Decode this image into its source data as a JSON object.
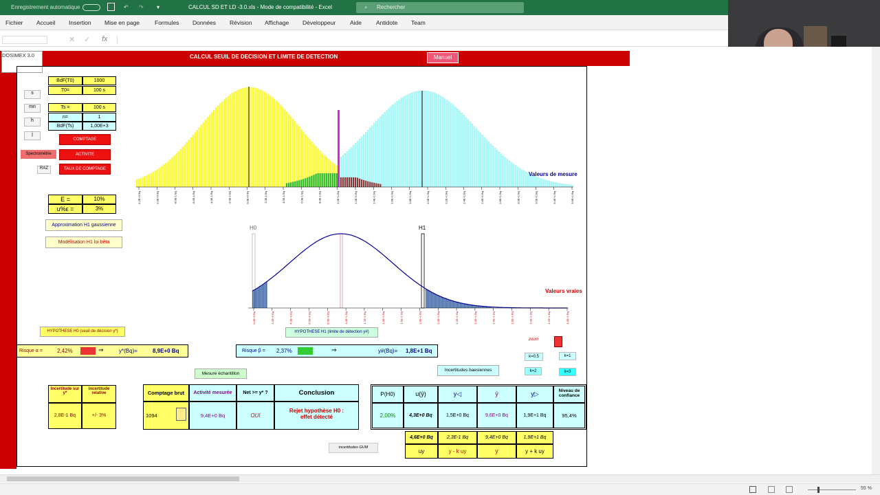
{
  "titlebar": {
    "autosave": "Enregistrement automatique",
    "doc_title": "CALCUL SD ET LD -3.0.xls  -  Mode de compatibilité  -  Excel",
    "search_placeholder": "Rechercher"
  },
  "ribbon": {
    "tabs": [
      "Fichier",
      "Accueil",
      "Insertion",
      "Mise en page",
      "Formules",
      "Données",
      "Révision",
      "Affichage",
      "Développeur",
      "Aide",
      "Antidote",
      "Team"
    ]
  },
  "formula_bar": {
    "fx": "fx"
  },
  "sheet": {
    "logo": "DOSIMEX 3.0",
    "banner_title": "CALCUL SEUIL DE DECISION ET LIMITE DE DETECTION",
    "manual_button": "Manuel",
    "time_units": [
      "s",
      "mn",
      "h",
      "j"
    ],
    "spectrometrie": "Spectrométrie",
    "raz": "RAZ",
    "mode_buttons": [
      "COMPTAGE",
      "ACTIVITE",
      "TAUX DE COMPTAGE"
    ],
    "params": {
      "bdf_label": "BdF(T0)",
      "bdf_value": "1000",
      "t0_label": "T0=",
      "t0_value": "100 s",
      "ts_label": "Ts =",
      "ts_value": "100 s",
      "n_label": "n=",
      "n_value": "1",
      "bdfts_label": "BdF(Ts)",
      "bdfts_value": "1,00E+3"
    },
    "eff": {
      "e_label": "E =",
      "e_value": "10%",
      "u_label": "u%ε =",
      "u_value": "3%"
    },
    "approx_button": "Approximation  H1  gaussienne",
    "model_button": "Modélisation  H1  loi bêta",
    "chart1_label": "Valeurs de mesure",
    "chart2_label": "Valeurs vraies",
    "h0": "H0",
    "h1": "H1",
    "chart1_ticks": [
      "-1.2E+0 Bq",
      "-1.0E+0 Bq",
      "-8.0E-1 Bq",
      "-6.0E-1 Bq",
      "-4.0E-1 Bq",
      "-2.0E-1 Bq",
      "0.0E+0 Bq",
      "2.0E-1 Bq",
      "4.0E-1 Bq",
      "6.0E-1 Bq",
      "8.0E-1 Bq",
      "1.0E+1 Bq",
      "1.2E+1 Bq",
      "1.4E+1 Bq",
      "1.6E+1 Bq",
      "1.8E+1 Bq",
      "2.0E+1 Bq",
      "2.2E+1 Bq",
      "2.4E+1 Bq",
      "2.6E+1 Bq",
      "2.8E+1 Bq",
      "3.0E+1 Bq",
      "3.2E+1 Bq",
      "3.4E+1 Bq",
      "3.6E+1 Bq"
    ],
    "chart2_ticks": [
      "0.0E+0 Bq",
      "2.0E+0 Bq",
      "4.0E+0 Bq",
      "6.0E+0 Bq",
      "8.0E+0 Bq",
      "1.0E+1 Bq",
      "1.2E+1 Bq",
      "1.4E+1 Bq",
      "1.6E+1 Bq",
      "1.8E+1 Bq",
      "2.0E+1 Bq",
      "2.2E+1 Bq",
      "2.4E+1 Bq",
      "2.6E+1 Bq",
      "2.8E+1 Bq",
      "3.0E+1 Bq",
      "3.2E+1 Bq",
      "3.4E+1 Bq"
    ],
    "hyp0_button": "HYPOTHESE H0 (seuil de décision y*)",
    "hyp1_button": "HYPOTHESE H1   (limite de détection y#)",
    "risk_alpha_label": "Risque α =",
    "risk_alpha_value": "2,42%",
    "ystar_label": "y*(Bq)=",
    "ystar_value": "8,9E+0 Bq",
    "risk_beta_label": "Risque β =",
    "risk_beta_value": "2,37%",
    "ysharp_label": "y#(Bq)=",
    "ysharp_value": "1,8E+1 Bq",
    "arrow": "⇒",
    "zoom_label": "zoom",
    "k_buttons": [
      "k=0,5",
      "k=1",
      "k=2",
      "k=3"
    ],
    "mesure_button": "Mesure échantillon",
    "bayes_button": "Incertitudes baesiennes",
    "gum_button": "incertitudes GUM",
    "unc_table": {
      "h1": "Incertitude sur y*",
      "h2": "incertitude relative",
      "v1": "2,8E-1 Bq",
      "v2": "+/- 3%"
    },
    "result_table": {
      "h_comptage": "Comptage brut",
      "h_activite": "Activité mesurée",
      "h_net": "Net >= y* ?",
      "h_conclusion": "Conclusion",
      "comptage": "1094",
      "activite": "9,4E+0 Bq",
      "net": "OUI",
      "conclusion": "Rejet hypothèse H0 : effet détecté"
    },
    "bayes_table": {
      "headers": [
        "P(H0)",
        "u(ŷ)",
        "y◁",
        "ŷ",
        "y▷",
        "Niveau de confiance"
      ],
      "values": [
        "2,00%",
        "4,3E+0 Bq",
        "1,5E+0 Bq",
        "9,6E+0 Bq",
        "1,9E+1 Bq",
        "95,4%"
      ]
    },
    "gum_table": {
      "values": [
        "4,6E+0 Bq",
        "2,3E-1 Bq",
        "9,4E+0 Bq",
        "1,9E+1 Bq"
      ],
      "labels": [
        "uy",
        "y - k uy",
        "y",
        "y + k uy"
      ]
    }
  },
  "statusbar": {
    "zoom": "55 %"
  }
}
